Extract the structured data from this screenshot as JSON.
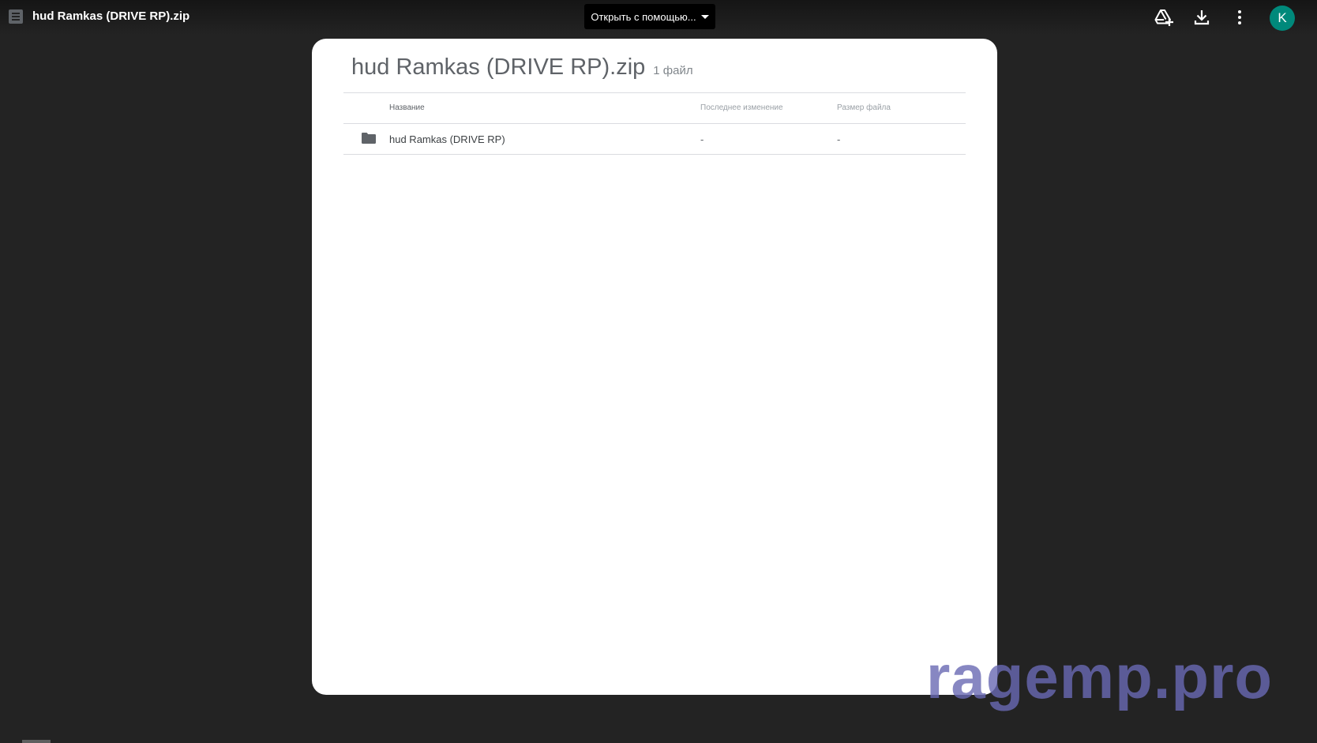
{
  "topbar": {
    "title": "hud Ramkas (DRIVE RP).zip",
    "open_with_label": "Открыть с помощью...",
    "icons": [
      "add-to-drive-icon",
      "download-icon",
      "more-vert-icon"
    ],
    "avatar_letter": "K",
    "avatar_color": "#00897b"
  },
  "archive": {
    "title": "hud Ramkas (DRIVE RP).zip",
    "file_count": "1 файл",
    "columns": {
      "name": "Название",
      "modified": "Последнее изменение",
      "size": "Размер файла"
    },
    "rows": [
      {
        "icon": "folder-icon",
        "name": "hud Ramkas (DRIVE RP)",
        "modified": "-",
        "size": "-"
      }
    ]
  },
  "watermark": "ragemp.pro"
}
